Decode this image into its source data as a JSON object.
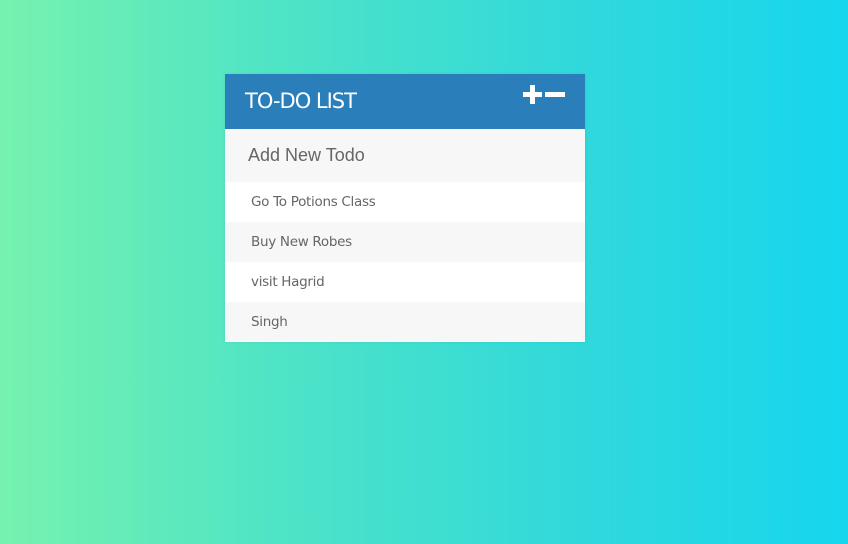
{
  "app": {
    "title": "TO-DO LIST"
  },
  "header": {
    "toggle_icon": "plus-minus-icon"
  },
  "add_todo": {
    "placeholder": "Add New Todo"
  },
  "todos": [
    {
      "text": "Go To Potions Class"
    },
    {
      "text": "Buy New Robes"
    },
    {
      "text": "visit Hagrid"
    },
    {
      "text": "Singh"
    }
  ],
  "colors": {
    "header": "#2a7fba",
    "gradient_start": "#76f2ae",
    "gradient_end": "#16d6ee",
    "row_alt": "#f7f7f7",
    "row": "#ffffff"
  }
}
